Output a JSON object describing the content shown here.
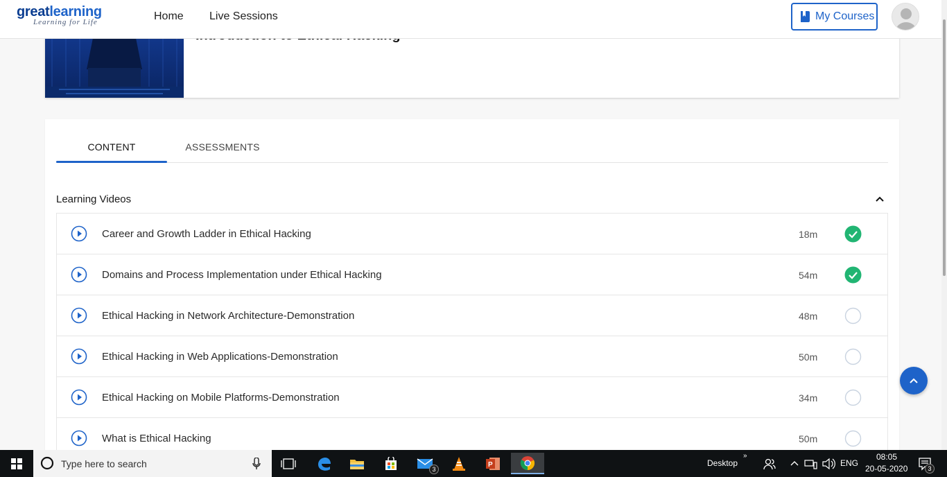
{
  "nav": {
    "logo_part1": "great",
    "logo_part2": "learning",
    "logo_tagline": "Learning for Life",
    "links": [
      "Home",
      "Live Sessions"
    ],
    "my_courses_label": "My Courses"
  },
  "course": {
    "title": "Introduction to Ethical Hacking"
  },
  "tabs": [
    {
      "label": "CONTENT",
      "active": true
    },
    {
      "label": "ASSESSMENTS",
      "active": false
    }
  ],
  "section": {
    "title": "Learning Videos"
  },
  "videos": [
    {
      "title": "Career and Growth Ladder in Ethical Hacking",
      "duration": "18m",
      "completed": true
    },
    {
      "title": "Domains and Process Implementation under Ethical Hacking",
      "duration": "54m",
      "completed": true
    },
    {
      "title": "Ethical Hacking in Network Architecture-Demonstration",
      "duration": "48m",
      "completed": false
    },
    {
      "title": "Ethical Hacking in Web Applications-Demonstration",
      "duration": "50m",
      "completed": false
    },
    {
      "title": "Ethical Hacking on Mobile Platforms-Demonstration",
      "duration": "34m",
      "completed": false
    },
    {
      "title": "What is Ethical Hacking",
      "duration": "50m",
      "completed": false
    }
  ],
  "colors": {
    "accent": "#1e63c9",
    "complete": "#21b573",
    "pending_ring": "#c9d3e0"
  },
  "taskbar": {
    "search_placeholder": "Type here to search",
    "desktop_label": "Desktop",
    "language": "ENG",
    "time": "08:05",
    "date": "20-05-2020",
    "mail_badge": "3",
    "notification_badge": "3"
  }
}
